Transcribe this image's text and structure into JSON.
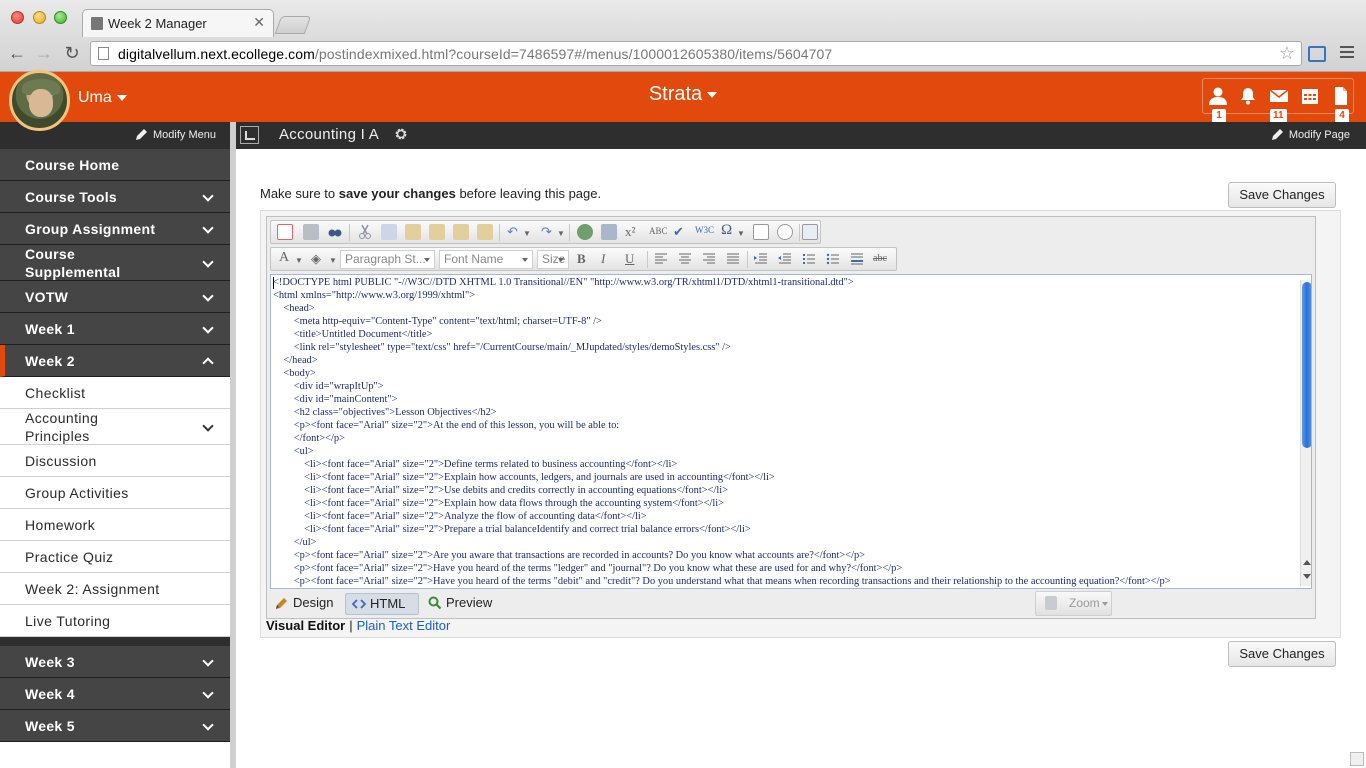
{
  "browser": {
    "tab_title": "Week 2 Manager",
    "url_host": "digitalvellum.next.ecollege.com",
    "url_path": "/postindexmixed.html?courseId=7486597#/menus/1000012605380/items/5604707"
  },
  "header": {
    "user_name": "Uma",
    "app_title": "Strata",
    "badges": {
      "profile": "1",
      "messages": "11",
      "documents": "4"
    },
    "accent_color": "#e14a0c"
  },
  "subheader": {
    "modify_menu": "Modify Menu",
    "course_title": "Accounting I A",
    "modify_page": "Modify Page"
  },
  "sidebar": {
    "items": [
      {
        "label": "Course Home",
        "type": "dark"
      },
      {
        "label": "Course Tools",
        "type": "dark",
        "chevron": "down"
      },
      {
        "label": "Group Assignment",
        "type": "dark",
        "chevron": "down"
      },
      {
        "label": "Course\nSupplemental",
        "type": "dark",
        "chevron": "down"
      },
      {
        "label": "VOTW",
        "type": "dark",
        "chevron": "down"
      },
      {
        "label": "Week 1",
        "type": "dark",
        "chevron": "down"
      },
      {
        "label": "Week 2",
        "type": "dark",
        "chevron": "up",
        "active": true
      },
      {
        "label": "Checklist",
        "type": "light"
      },
      {
        "label": "Accounting\nPrinciples",
        "type": "light",
        "chevron": "down"
      },
      {
        "label": "Discussion",
        "type": "light"
      },
      {
        "label": "Group Activities",
        "type": "light"
      },
      {
        "label": "Homework",
        "type": "light"
      },
      {
        "label": "Practice Quiz",
        "type": "light"
      },
      {
        "label": "Week 2: Assignment",
        "type": "light"
      },
      {
        "label": "Live Tutoring",
        "type": "light"
      },
      {
        "label": "Week 3",
        "type": "dark",
        "chevron": "down"
      },
      {
        "label": "Week 4",
        "type": "dark",
        "chevron": "down"
      },
      {
        "label": "Week 5",
        "type": "dark",
        "chevron": "down"
      }
    ]
  },
  "main": {
    "notice_prefix": "Make sure to ",
    "notice_bold": "save your changes",
    "notice_suffix": " before leaving this page.",
    "save_label": "Save Changes"
  },
  "editor": {
    "paragraph_style": "Paragraph St...",
    "font_name": "Font Name",
    "size": "Size",
    "code_lines": [
      "<!DOCTYPE html PUBLIC \"-//W3C//DTD XHTML 1.0 Transitional//EN\" \"http://www.w3.org/TR/xhtml1/DTD/xhtml1-transitional.dtd\">",
      "<html xmlns=\"http://www.w3.org/1999/xhtml\">",
      "    <head>",
      "        <meta http-equiv=\"Content-Type\" content=\"text/html; charset=UTF-8\" />",
      "        <title>Untitled Document</title>",
      "        <link rel=\"stylesheet\" type=\"text/css\" href=\"/CurrentCourse/main/_MJupdated/styles/demoStyles.css\" />",
      "    </head>",
      "    <body>",
      "        <div id=\"wrapItUp\">",
      "        <div id=\"mainContent\">",
      "        <h2 class=\"objectives\">Lesson Objectives</h2>",
      "        <p><font face=\"Arial\" size=\"2\">At the end of this lesson, you will be able to:",
      "        </font></p>",
      "        <ul>",
      "            <li><font face=\"Arial\" size=\"2\">Define terms related to business accounting</font></li>",
      "            <li><font face=\"Arial\" size=\"2\">Explain how accounts, ledgers, and journals are used in accounting</font></li>",
      "            <li><font face=\"Arial\" size=\"2\">Use debits and credits correctly in accounting equations</font></li>",
      "            <li><font face=\"Arial\" size=\"2\">Explain how data flows through the accounting system</font></li>",
      "            <li><font face=\"Arial\" size=\"2\">Analyze the flow of accounting data</font></li>",
      "            <li><font face=\"Arial\" size=\"2\">Prepare a trial balanceIdentify and correct trial balance errors</font></li>",
      "        </ul>",
      "        <p><font face=\"Arial\" size=\"2\">Are you aware that transactions are recorded in accounts? Do you know what accounts are?</font></p>",
      "        <p><font face=\"Arial\" size=\"2\">Have you heard of the terms \"ledger\" and \"journal\"? Do you know what these are used for and why?</font></p>",
      "        <p><font face=\"Arial\" size=\"2\">Have you heard of the terms \"debit\" and \"credit\"? Do you understand what that means when recording transactions and their relationship to the accounting equation?</font></p>"
    ],
    "modes": {
      "design": "Design",
      "html": "HTML",
      "preview": "Preview"
    },
    "zoom": "Zoom",
    "visual_editor": "Visual Editor",
    "separator": "|",
    "plain_text_editor": "Plain Text Editor"
  }
}
